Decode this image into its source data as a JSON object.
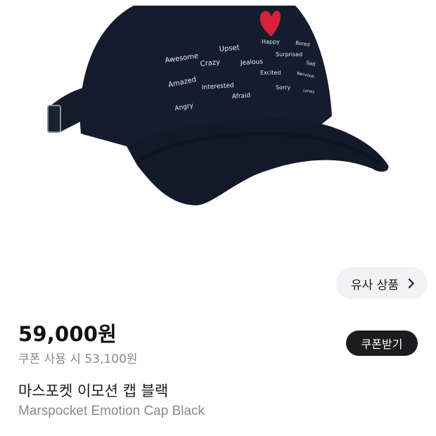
{
  "product_image": {
    "alt": "",
    "embroidery_words": [
      "Awesome",
      "Upset",
      "Happy",
      "Bored",
      "Crazy",
      "Jealous",
      "Surprised",
      "Sad",
      "Amazed",
      "Interested",
      "Excited",
      "Nervous",
      "Angry",
      "Afraid",
      "Sorry",
      "Lonely"
    ],
    "cap_color": "#131d2e",
    "heart_color": "#d6223a"
  },
  "similar": {
    "label": "유사 상품"
  },
  "price": {
    "value": "59,000원",
    "coupon_text": "쿠폰 사용 시 53,100원"
  },
  "coupon_button": {
    "label": "쿠폰받기"
  },
  "product": {
    "name_ko": "마스포켓 이모션 캡 블랙",
    "name_en": "Marspocket Emotion Cap Black"
  }
}
